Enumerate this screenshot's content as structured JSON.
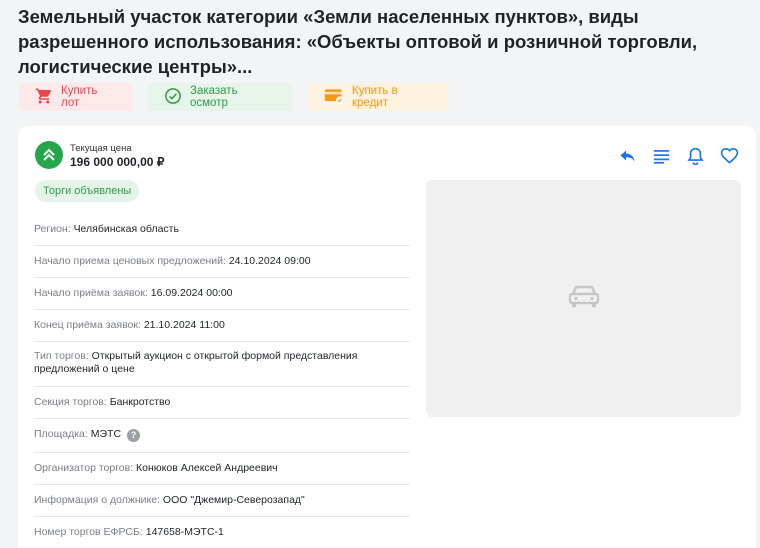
{
  "lot": {
    "title": "Земельный участок категории «Земли населенных пунктов», виды разрешенного использования: «Объекты оптовой и розничной торговли, логистические центры»..."
  },
  "actions": {
    "buy_label": "Купить лот",
    "view_label": "Заказать осмотр",
    "credit_label": "Купить в кредит"
  },
  "colors": {
    "buy": "#e8454a",
    "view": "#2e9a48",
    "credit": "#f39a12",
    "accent": "#1a73e8",
    "price_badge": "#26a64b"
  },
  "price": {
    "label": "Текущая цена",
    "value": "196 000 000,00 ₽"
  },
  "toolbar": {
    "icons": [
      "reply-icon",
      "list-icon",
      "bell-icon",
      "heart-icon"
    ]
  },
  "status": "Торги объявлены",
  "details": [
    {
      "label": "Регион:",
      "value": "Челябинская область"
    },
    {
      "label": "Начало приема ценовых предложений:",
      "value": "24.10.2024 09:00"
    },
    {
      "label": "Начало приёма заявок:",
      "value": "16.09.2024 00:00"
    },
    {
      "label": "Конец приёма заявок:",
      "value": "21.10.2024 11:00"
    },
    {
      "label": "Тип торгов:",
      "value": "Открытый аукцион с открытой формой представления предложений о цене"
    },
    {
      "label": "Секция торгов:",
      "value": "Банкротство"
    },
    {
      "label": "Площадка:",
      "value": "МЭТС"
    },
    {
      "label": "Организатор торгов:",
      "value": "Конюков Алексей Андреевич"
    },
    {
      "label": "Информация о должнике:",
      "value": "ООО \"Джемир-Северозапад\""
    },
    {
      "label": "Номер торгов ЕФРСБ:",
      "value": "147658-МЭТС-1"
    }
  ],
  "image": {
    "icon": "car-placeholder-icon"
  }
}
